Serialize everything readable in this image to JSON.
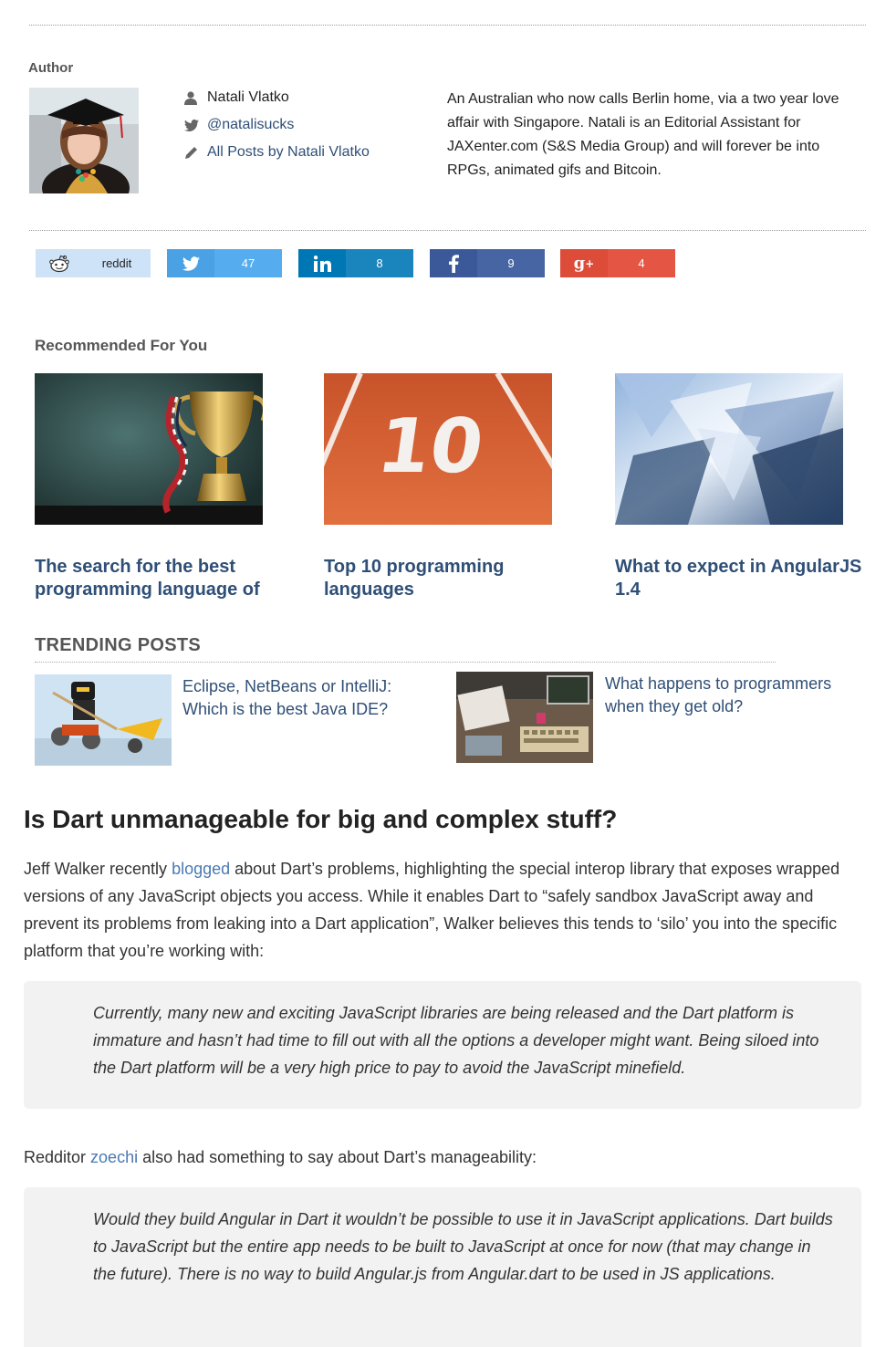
{
  "author": {
    "heading": "Author",
    "name": "Natali Vlatko",
    "twitter": "@natalisucks",
    "all_posts": "All Posts by Natali Vlatko",
    "bio": "An Australian who now calls Berlin home, via a two year love affair with Singapore. Natali is an Editorial Assistant for JAXenter.com (S&S Media Group) and will forever be into RPGs, animated gifs and Bitcoin."
  },
  "share": [
    {
      "network": "reddit",
      "label": "reddit",
      "icon": "reddit-icon",
      "color": "#cee3f8",
      "text_color": "#222222"
    },
    {
      "network": "twitter",
      "label": "47",
      "icon": "twitter-icon",
      "color": "#55acee",
      "text_color": "#ffffff"
    },
    {
      "network": "linkedin",
      "label": "8",
      "icon": "linkedin-icon",
      "color": "#0077b5",
      "text_color": "#ffffff"
    },
    {
      "network": "facebook",
      "label": "9",
      "icon": "facebook-icon",
      "color": "#3b5998",
      "text_color": "#ffffff"
    },
    {
      "network": "googleplus",
      "label": "4",
      "icon": "google-plus-icon",
      "color": "#dd4b39",
      "text_color": "#ffffff"
    }
  ],
  "recommended": {
    "title": "Recommended For You",
    "items": [
      {
        "title": "The search for the best programming language of",
        "image": "trophy-image"
      },
      {
        "title": "Top 10 programming languages",
        "image": "running-track-10-image"
      },
      {
        "title": "What to expect in AngularJS 1.4",
        "image": "abstract-glass-image"
      }
    ]
  },
  "trending": {
    "title": "TRENDING POSTS",
    "items": [
      {
        "title": "Eclipse, NetBeans or IntelliJ: Which is the best Java IDE?",
        "image": "lego-ninja-image"
      },
      {
        "title": "What happens to programmers when they get old?",
        "image": "retro-computer-desk-image"
      }
    ]
  },
  "article": {
    "heading": "Is Dart unmanageable for big and complex stuff?",
    "para1_before": "Jeff Walker recently ",
    "para1_link": "blogged",
    "para1_after": " about Dart’s problems, highlighting the special interop library that exposes wrapped versions of any JavaScript objects you access. While it enables Dart to “safely sandbox JavaScript away and prevent its problems from leaking into a Dart application”, Walker believes this tends to ‘silo’ you into the specific platform that you’re working with:",
    "quote1": "Currently, many new and exciting JavaScript libraries are being released and the Dart platform is immature and hasn’t had time to fill out with all the options a developer might want. Being siloed into the Dart platform will be a very high price to pay to avoid the JavaScript minefield.",
    "para2_before": "Redditor ",
    "para2_link": "zoechi",
    "para2_after": " also had something to say about Dart’s manageability:",
    "quote2": "Would they build Angular in Dart it wouldn’t be possible to use it in JavaScript applications. Dart builds to JavaScript but the entire app needs to be built to JavaScript at once for now (that may change in the future). There is no way to build Angular.js from Angular.dart to be used in JS applications."
  },
  "colors": {
    "link": "#2f4f77",
    "inline_link": "#4a7ab3",
    "quote_bg": "#f2f2f2"
  }
}
